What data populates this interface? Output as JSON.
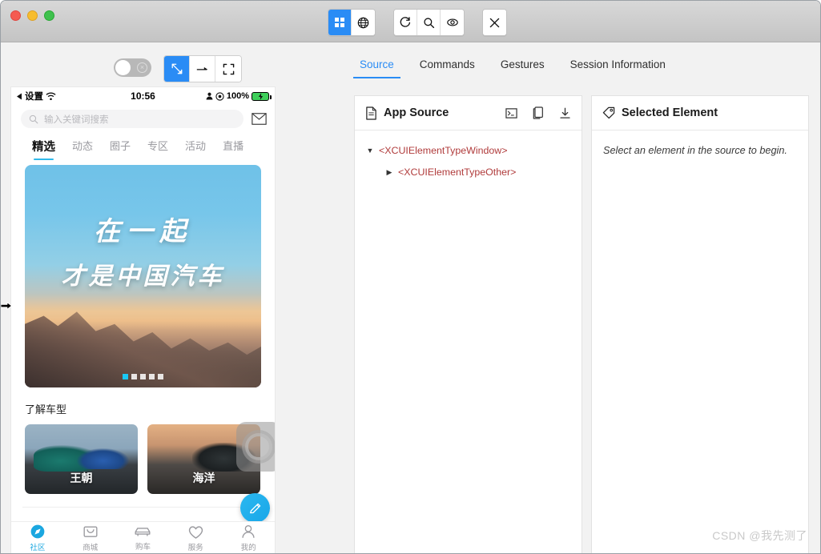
{
  "window": {
    "traffic_lights": [
      "close",
      "minimize",
      "zoom"
    ]
  },
  "toolbar": {
    "groups": [
      {
        "buttons": [
          {
            "name": "grid-view",
            "icon": "grid-icon",
            "active": true
          },
          {
            "name": "globe-view",
            "icon": "globe-icon",
            "active": false
          }
        ]
      },
      {
        "buttons": [
          {
            "name": "refresh",
            "icon": "refresh-icon",
            "active": false
          },
          {
            "name": "search",
            "icon": "search-icon",
            "active": false
          },
          {
            "name": "inspect",
            "icon": "eye-icon",
            "active": false
          }
        ]
      },
      {
        "buttons": [
          {
            "name": "close-session",
            "icon": "x-icon",
            "active": false
          }
        ]
      }
    ]
  },
  "subtoolbar": {
    "toggle": {
      "state": "off",
      "badge": "×"
    },
    "mode_buttons": [
      {
        "name": "select-mode",
        "icon": "cursor-select-icon",
        "active": true
      },
      {
        "name": "swipe-mode",
        "icon": "arrow-right-icon",
        "active": false
      },
      {
        "name": "fullscreen-mode",
        "icon": "expand-icon",
        "active": false
      }
    ]
  },
  "tabs": [
    {
      "label": "Source",
      "active": true
    },
    {
      "label": "Commands",
      "active": false
    },
    {
      "label": "Gestures",
      "active": false
    },
    {
      "label": "Session Information",
      "active": false
    }
  ],
  "source_panel": {
    "title": "App Source",
    "title_icon": "document-icon",
    "actions": [
      {
        "name": "terminal-icon",
        "label": "Show XML"
      },
      {
        "name": "copy-icon",
        "label": "Copy"
      },
      {
        "name": "download-icon",
        "label": "Download"
      }
    ],
    "tree": [
      {
        "level": 1,
        "expanded": true,
        "text": "<XCUIElementTypeWindow>"
      },
      {
        "level": 2,
        "expanded": false,
        "text": "<XCUIElementTypeOther>"
      }
    ]
  },
  "selected_panel": {
    "title": "Selected Element",
    "title_icon": "tag-icon",
    "empty_message": "Select an element in the source to begin."
  },
  "phone": {
    "status_bar": {
      "left_label": "设置",
      "back_icon": "back-triangle-icon",
      "wifi_icon": "wifi-icon",
      "time": "10:56",
      "person_icon": "person-icon",
      "location_icon": "location-icon",
      "battery_percent": "100%",
      "battery_icon": "battery-charging-icon"
    },
    "search": {
      "icon": "search-icon",
      "placeholder": "输入关键词搜索",
      "mail_icon": "mail-icon"
    },
    "nav_tabs": [
      {
        "label": "精选",
        "active": true
      },
      {
        "label": "动态",
        "active": false
      },
      {
        "label": "圈子",
        "active": false
      },
      {
        "label": "专区",
        "active": false
      },
      {
        "label": "活动",
        "active": false
      },
      {
        "label": "直播",
        "active": false
      }
    ],
    "banner": {
      "line1": "在一起",
      "line2": "才是中国汽车",
      "dots": 5,
      "active_dot": 0
    },
    "section": {
      "title": "了解车型",
      "cards": [
        {
          "label": "王朝"
        },
        {
          "label": "海洋"
        }
      ]
    },
    "floating": {
      "app_switcher_icon": "assistive-touch-icon",
      "fab_icon": "pencil-icon"
    },
    "tab_bar": [
      {
        "label": "社区",
        "icon": "compass-icon",
        "active": true
      },
      {
        "label": "商城",
        "icon": "bag-icon",
        "active": false
      },
      {
        "label": "购车",
        "icon": "car-icon",
        "active": false
      },
      {
        "label": "服务",
        "icon": "heart-icon",
        "active": false
      },
      {
        "label": "我的",
        "icon": "person-icon",
        "active": false
      }
    ]
  },
  "watermark": "CSDN @我先测了",
  "colors": {
    "accent": "#2a8cf5",
    "phone_accent": "#1ba7e0",
    "node_red": "#b03b3b"
  }
}
